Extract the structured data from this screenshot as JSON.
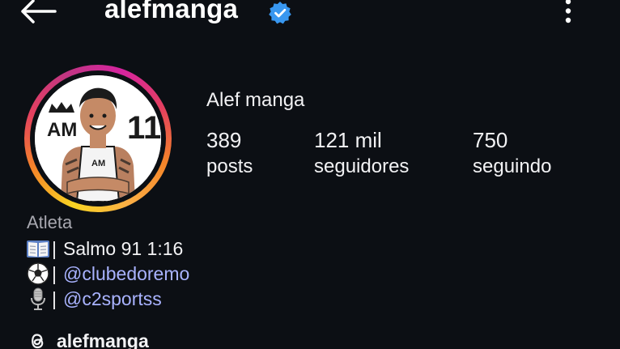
{
  "header": {
    "username": "alefmanga",
    "back_icon": "arrow-left-icon",
    "verified_icon": "verified-badge-icon",
    "more_icon": "more-vertical-icon"
  },
  "profile": {
    "display_name": "Alef manga",
    "avatar": {
      "monogram": "AM",
      "number": "11",
      "shirt_text": "AM"
    }
  },
  "stats": [
    {
      "value": "389",
      "label": "posts"
    },
    {
      "value": "121 mil",
      "label": "seguidores"
    },
    {
      "value": "750",
      "label": "seguindo"
    }
  ],
  "bio": {
    "category": "Atleta",
    "lines": [
      {
        "icon": "book-emoji",
        "sep": "|",
        "text": "Salmo 91 1:16"
      },
      {
        "icon": "soccer-ball-emoji",
        "sep": "|",
        "text": "@clubedoremo"
      },
      {
        "icon": "microphone-emoji",
        "sep": "|",
        "text": "@c2sportss"
      }
    ]
  },
  "threads": {
    "icon": "threads-icon",
    "handle": "alefmanga"
  },
  "colors": {
    "background": "#0c0f14",
    "text": "#f2f2f4",
    "muted": "#a8a8b0",
    "link": "#a9b3ff",
    "verified": "#3897f0"
  }
}
